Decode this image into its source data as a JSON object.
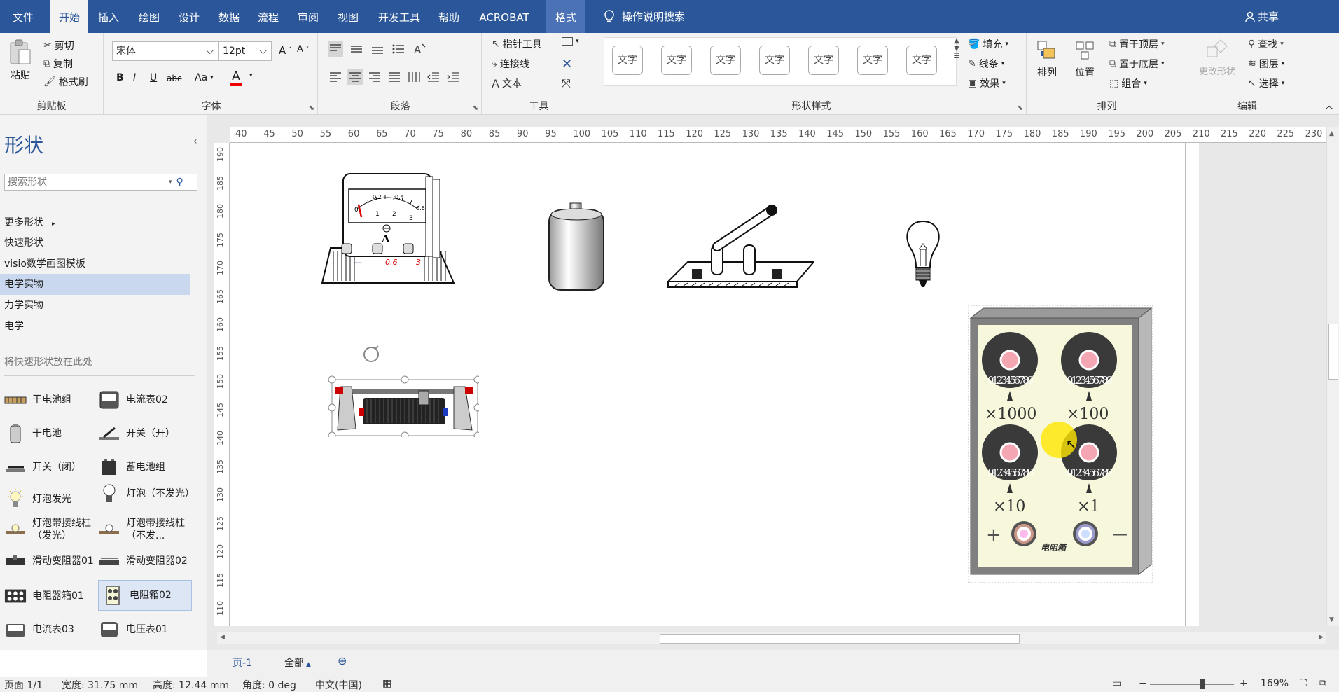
{
  "tabs": [
    "文件",
    "开始",
    "插入",
    "绘图",
    "设计",
    "数据",
    "流程",
    "审阅",
    "视图",
    "开发工具",
    "帮助",
    "ACROBAT",
    "格式"
  ],
  "tell_me": "操作说明搜索",
  "share": "共享",
  "ribbon": {
    "clipboard": {
      "paste": "粘贴",
      "cut": "剪切",
      "copy": "复制",
      "format_painter": "格式刷",
      "label": "剪贴板"
    },
    "font": {
      "name": "宋体",
      "size": "12pt",
      "grow": "A",
      "shrink": "A",
      "bold": "B",
      "italic": "I",
      "underline": "U",
      "strike": "abc",
      "case": "Aa",
      "color_a": "A",
      "label": "字体"
    },
    "paragraph": {
      "label": "段落"
    },
    "tools": {
      "pointer": "指针工具",
      "connector": "连接线",
      "text": "文本",
      "label": "工具"
    },
    "shape_styles": {
      "items": [
        "文字",
        "文字",
        "文字",
        "文字",
        "文字",
        "文字",
        "文字"
      ],
      "fill": "填充",
      "line": "线条",
      "effect": "效果",
      "label": "形状样式"
    },
    "arrange": {
      "arrange": "排列",
      "position": "位置",
      "bring_front": "置于顶层",
      "send_back": "置于底层",
      "group": "组合",
      "label": "排列"
    },
    "edit": {
      "change_shape": "更改形状",
      "find": "查找",
      "layers": "图层",
      "select": "选择",
      "label": "编辑"
    }
  },
  "panel": {
    "title": "形状",
    "search_placeholder": "搜索形状",
    "nav": [
      "更多形状",
      "快速形状",
      "visio数学画图模板",
      "电学实物",
      "力学实物",
      "电学"
    ],
    "selected_nav": "电学实物",
    "hint": "将快速形状放在此处",
    "shapes": [
      [
        "干电池组",
        "电流表02"
      ],
      [
        "干电池",
        "开关（开）"
      ],
      [
        "开关（闭）",
        "蓄电池组"
      ],
      [
        "灯泡发光",
        "灯泡（不发光）"
      ],
      [
        "灯泡带接线柱（发光）",
        "灯泡带接线柱（不发..."
      ],
      [
        "滑动变阻器01",
        "滑动变阻器02"
      ],
      [
        "电阻器箱01",
        "电阻箱02"
      ],
      [
        "电流表03",
        "电压表01"
      ]
    ]
  },
  "ruler": {
    "h": [
      "40",
      "45",
      "50",
      "55",
      "60",
      "65",
      "70",
      "75",
      "80",
      "85",
      "90",
      "95",
      "100",
      "105",
      "110",
      "115",
      "120",
      "125",
      "130",
      "135",
      "140",
      "145",
      "150",
      "155",
      "160",
      "165",
      "170",
      "175",
      "180",
      "185",
      "190",
      "195",
      "200",
      "205",
      "210",
      "215",
      "220",
      "225",
      "230"
    ],
    "v": [
      "190",
      "185",
      "180",
      "175",
      "170",
      "165",
      "160",
      "155",
      "150",
      "145",
      "140",
      "135",
      "130",
      "125",
      "120",
      "115",
      "110"
    ]
  },
  "canvas": {
    "ammeter": {
      "scale": [
        "0",
        "0.2",
        "0.4",
        "0.6",
        "1",
        "2",
        "3"
      ],
      "symbol": "A",
      "terminals": [
        "—",
        "0.6",
        "3"
      ]
    },
    "resistance_box": {
      "multipliers": [
        "×1000",
        "×100",
        "×10",
        "×1"
      ],
      "plus": "+",
      "minus": "—",
      "label": "电阻箱",
      "dial_digits": "0123456789"
    }
  },
  "pagebar": {
    "page": "页-1",
    "all": "全部"
  },
  "status": {
    "page": "页面 1/1",
    "width": "宽度: 31.75 mm",
    "height": "高度: 12.44 mm",
    "angle": "角度: 0 deg",
    "lang": "中文(中国)",
    "zoom": "169%"
  }
}
